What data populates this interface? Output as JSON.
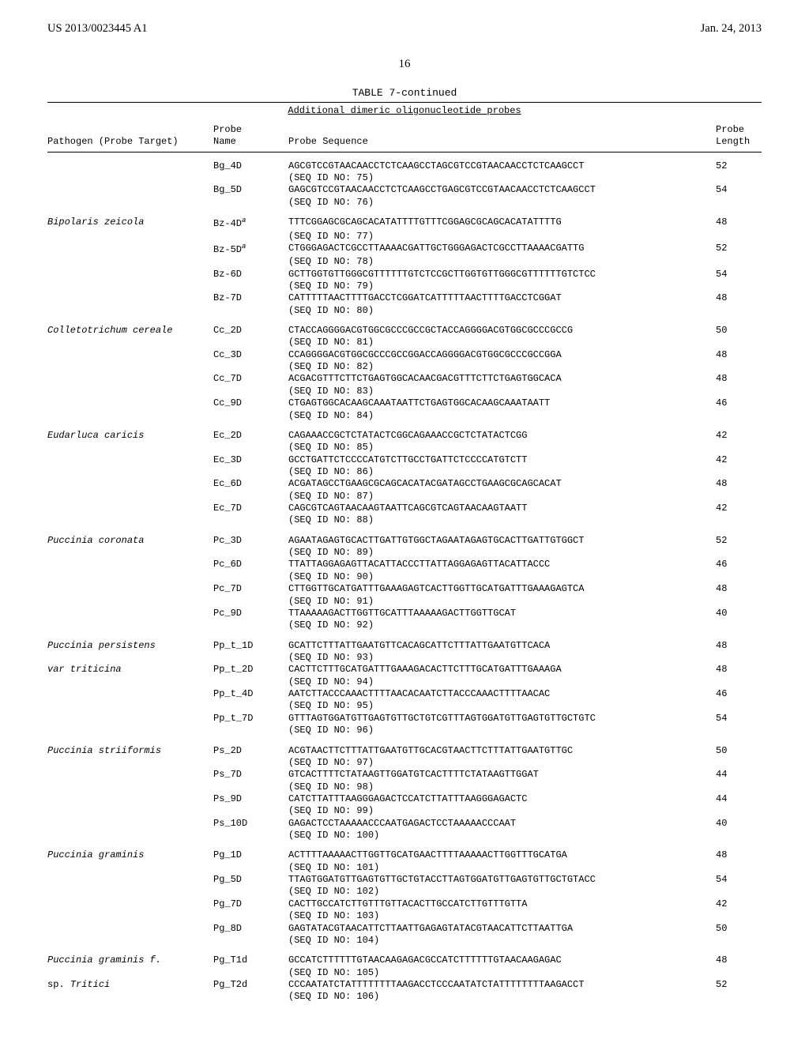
{
  "header": {
    "left": "US 2013/0023445 A1",
    "right": "Jan. 24, 2013"
  },
  "page_number": "16",
  "table": {
    "title": "TABLE 7-continued",
    "subheader": "Additional dimeric oligonucleotide probes",
    "col_headers": {
      "c1": "Pathogen (Probe Target)",
      "c2a": "Probe",
      "c2b": "Name",
      "c3": "Probe Sequence",
      "c4a": "Probe",
      "c4b": "Length"
    },
    "groups": [
      {
        "pathogen": "",
        "rows": [
          {
            "name": "Bg_4D",
            "seq": "AGCGTCCGTAACAACCTCTCAAGCCTAGCGTCCGTAACAACCTCTCAAGCCT",
            "seqid": "(SEQ ID NO: 75)",
            "len": "52"
          },
          {
            "name": "Bg_5D",
            "seq": "GAGCGTCCGTAACAACCTCTCAAGCCTGAGCGTCCGTAACAACCTCTCAAGCCT",
            "seqid": "(SEQ ID NO: 76)",
            "len": "54"
          }
        ]
      },
      {
        "pathogen": "Bipolaris zeicola",
        "rows": [
          {
            "name": "Bz-4D",
            "sup": "a",
            "seq": "TTTCGGAGCGCAGCACATATTTTGTTTCGGAGCGCAGCACATATTTTG",
            "seqid": "(SEQ ID NO: 77)",
            "len": "48"
          },
          {
            "name": "Bz-5D",
            "sup": "a",
            "seq": "CTGGGAGACTCGCCTTAAAACGATTGCTGGGAGACTCGCCTTAAAACGATTG",
            "seqid": "(SEQ ID NO: 78)",
            "len": "52"
          },
          {
            "name": "Bz-6D",
            "seq": "GCTTGGTGTTGGGCGTTTTTTGTCTCCGCTTGGTGTTGGGCGTTTTTTGTCTCC",
            "seqid": "(SEQ ID NO: 79)",
            "len": "54"
          },
          {
            "name": "Bz-7D",
            "seq": "CATTTTTAACTTTTGACCTCGGATCATTTTTAACTTTTGACCTCGGAT",
            "seqid": "(SEQ ID NO: 80)",
            "len": "48"
          }
        ]
      },
      {
        "pathogen": "Colletotrichum cereale",
        "rows": [
          {
            "name": "Cc_2D",
            "seq": "CTACCAGGGGACGTGGCGCCCGCCGCTACCAGGGGACGTGGCGCCCGCCG",
            "seqid": "(SEQ ID NO: 81)",
            "len": "50"
          },
          {
            "name": "Cc_3D",
            "seq": "CCAGGGGACGTGGCGCCCGCCGGACCAGGGGACGTGGCGCCCGCCGGA",
            "seqid": "(SEQ ID NO: 82)",
            "len": "48"
          },
          {
            "name": "Cc_7D",
            "seq": "ACGACGTTTCTTCTGAGTGGCACAACGACGTTTCTTCTGAGTGGCACA",
            "seqid": "(SEQ ID NO: 83)",
            "len": "48"
          },
          {
            "name": "Cc_9D",
            "seq": "CTGAGTGGCACAAGCAAATAATTCTGAGTGGCACAAGCAAATAATT",
            "seqid": "(SEQ ID NO: 84)",
            "len": "46"
          }
        ]
      },
      {
        "pathogen": "Eudarluca caricis",
        "rows": [
          {
            "name": "Ec_2D",
            "seq": "CAGAAACCGCTCTATACTCGGCAGAAACCGCTCTATACTCGG",
            "seqid": "(SEQ ID NO: 85)",
            "len": "42"
          },
          {
            "name": "Ec_3D",
            "seq": "GCCTGATTCTCCCCATGTCTTGCCTGATTCTCCCCATGTCTT",
            "seqid": "(SEQ ID NO: 86)",
            "len": "42"
          },
          {
            "name": "Ec_6D",
            "seq": "ACGATAGCCTGAAGCGCAGCACATACGATAGCCTGAAGCGCAGCACAT",
            "seqid": "(SEQ ID NO: 87)",
            "len": "48"
          },
          {
            "name": "Ec_7D",
            "seq": "CAGCGTCAGTAACAAGTAATTCAGCGTCAGTAACAAGTAATT",
            "seqid": "(SEQ ID NO: 88)",
            "len": "42"
          }
        ]
      },
      {
        "pathogen": "Puccinia coronata",
        "rows": [
          {
            "name": "Pc_3D",
            "seq": "AGAATAGAGTGCACTTGATTGTGGCTAGAATAGAGTGCACTTGATTGTGGCT",
            "seqid": "(SEQ ID NO: 89)",
            "len": "52"
          },
          {
            "name": "Pc_6D",
            "seq": "TTATTAGGAGAGTTACATTACCCTTATTAGGAGAGTTACATTACCC",
            "seqid": "(SEQ ID NO: 90)",
            "len": "46"
          },
          {
            "name": "Pc_7D",
            "seq": "CTTGGTTGCATGATTTGAAAGAGTCACTTGGTTGCATGATTTGAAAGAGTCA",
            "seqid": "(SEQ ID NO: 91)",
            "len": "48"
          },
          {
            "name": "Pc_9D",
            "seq": "TTAAAAAGACTTGGTTGCATTTAAAAAGACTTGGTTGCAT",
            "seqid": "(SEQ ID NO: 92)",
            "len": "40"
          }
        ]
      },
      {
        "pathogen": "Puccinia persistens",
        "pathogen2": "var triticina",
        "rows": [
          {
            "name": "Pp_t_1D",
            "seq": "GCATTCTTTATTGAATGTTCACAGCATTCTTTATTGAATGTTCACA",
            "seqid": "(SEQ ID NO: 93)",
            "len": "48"
          },
          {
            "name": "Pp_t_2D",
            "seq": "CACTTCTTTGCATGATTTGAAAGACACTTCTTTGCATGATTTGAAAGA",
            "seqid": "(SEQ ID NO: 94)",
            "len": "48"
          },
          {
            "name": "Pp_t_4D",
            "seq": "AATCTTACCCAAACTTTTAACACAATCTTACCCAAACTTTTAACAC",
            "seqid": "(SEQ ID NO: 95)",
            "len": "46"
          },
          {
            "name": "Pp_t_7D",
            "seq": "GTTTAGTGGATGTTGAGTGTTGCTGTCGTTTAGTGGATGTTGAGTGTTGCTGTC",
            "seqid": "(SEQ ID NO: 96)",
            "len": "54"
          }
        ]
      },
      {
        "pathogen": "Puccinia striiformis",
        "rows": [
          {
            "name": "Ps_2D",
            "seq": "ACGTAACTTCTTTATTGAATGTTGCACGTAACTTCTTTATTGAATGTTGC",
            "seqid": "(SEQ ID NO: 97)",
            "len": "50"
          },
          {
            "name": "Ps_7D",
            "seq": "GTCACTTTTCTATAAGTTGGATGTCACTTTTCTATAAGTTGGAT",
            "seqid": "(SEQ ID NO: 98)",
            "len": "44"
          },
          {
            "name": "Ps_9D",
            "seq": "CATCTTATTTAAGGGAGACTCCATCTTATTTAAGGGAGACTC",
            "seqid": "(SEQ ID NO: 99)",
            "len": "44"
          },
          {
            "name": "Ps_10D",
            "seq": "GAGACTCCTAAAAACCCAATGAGACTCCTAAAAACCCAAT",
            "seqid": "(SEQ ID NO: 100)",
            "len": "40"
          }
        ]
      },
      {
        "pathogen": "Puccinia graminis",
        "rows": [
          {
            "name": "Pg_1D",
            "seq": "ACTTTTAAAAACTTGGTTGCATGAACTTTTAAAAACTTGGTTTGCATGA",
            "seqid": "(SEQ ID NO: 101)",
            "len": "48"
          },
          {
            "name": "Pg_5D",
            "seq": "TTAGTGGATGTTGAGTGTTGCTGTACCTTAGTGGATGTTGAGTGTTGCTGTACC",
            "seqid": "(SEQ ID NO: 102)",
            "len": "54"
          },
          {
            "name": "Pg_7D",
            "seq": "CACTTGCCATCTTGTTTGTTACACTTGCCATCTTGTTTGTTA",
            "seqid": "(SEQ ID NO: 103)",
            "len": "42"
          },
          {
            "name": "Pg_8D",
            "seq": "GAGTATACGTAACATTCTTAATTGAGAGTATACGTAACATTCTTAATTGA",
            "seqid": "(SEQ ID NO: 104)",
            "len": "50"
          }
        ]
      },
      {
        "pathogen": "Puccinia graminis f.",
        "pathogen2norm": "sp. ",
        "pathogen2": "Tritici",
        "rows": [
          {
            "name": "Pg_T1d",
            "seq": "GCCATCTTTTTTGTAACAAGAGACGCCATCTTTTTTGTAACAAGAGAC",
            "seqid": "(SEQ ID NO: 105)",
            "len": "48"
          },
          {
            "name": "Pg_T2d",
            "seq": "CCCAATATCTATTTTTTTTAAGACCTCCCAATATCTATTTTTTTTAAGACCT",
            "seqid": "(SEQ ID NO: 106)",
            "len": "52"
          }
        ]
      }
    ]
  }
}
